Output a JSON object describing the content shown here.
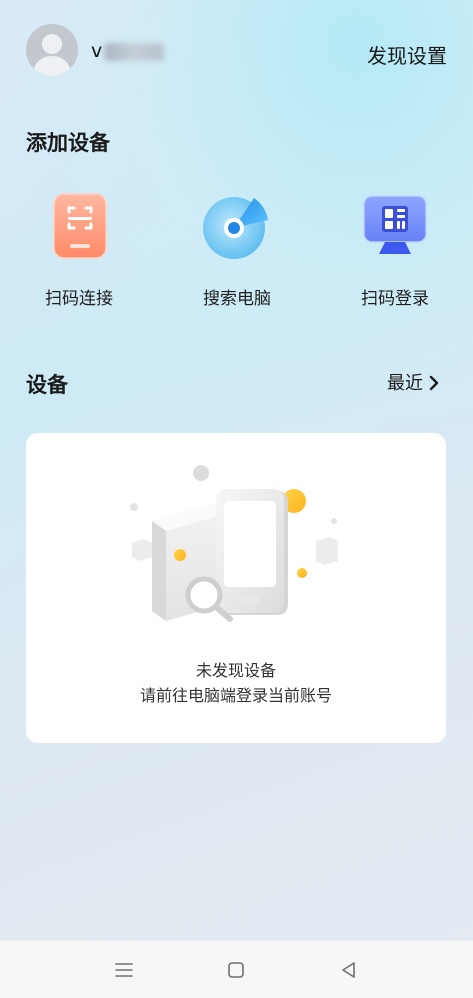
{
  "header": {
    "username_prefix": "v",
    "discover_settings_label": "发现设置"
  },
  "add_devices": {
    "title": "添加设备",
    "actions": [
      {
        "label": "扫码连接",
        "icon": "scan-connect-icon"
      },
      {
        "label": "搜索电脑",
        "icon": "search-computer-icon"
      },
      {
        "label": "扫码登录",
        "icon": "scan-login-icon"
      }
    ]
  },
  "devices": {
    "title": "设备",
    "recent_label": "最近",
    "empty_title": "未发现设备",
    "empty_subtitle": "请前往电脑端登录当前账号"
  },
  "colors": {
    "accent_orange": "#ff7a5a",
    "accent_blue": "#2f8fe8",
    "accent_indigo": "#3d5cf0",
    "card_bg": "#ffffff"
  },
  "navbar": {
    "buttons": [
      "menu-icon",
      "home-icon",
      "back-icon"
    ]
  }
}
